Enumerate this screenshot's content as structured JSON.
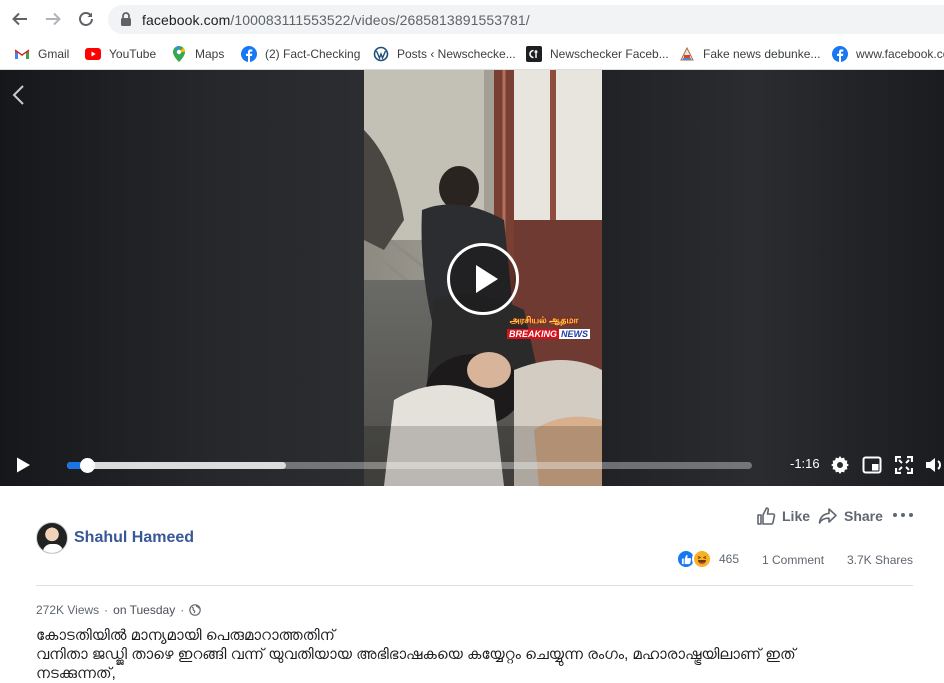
{
  "browser": {
    "url_host": "facebook.com",
    "url_path": "/100083111553522/videos/2685813891553781/",
    "bookmarks": [
      {
        "label": "Gmail",
        "icon": "gmail-icon"
      },
      {
        "label": "YouTube",
        "icon": "youtube-icon"
      },
      {
        "label": "Maps",
        "icon": "maps-icon"
      },
      {
        "label": "(2) Fact-Checking",
        "icon": "facebook-icon"
      },
      {
        "label": "Posts ‹ Newschecke...",
        "icon": "wordpress-icon"
      },
      {
        "label": "Newschecker Faceb...",
        "icon": "crowdtangle-icon"
      },
      {
        "label": "Fake news debunke...",
        "icon": "debunk-icon"
      },
      {
        "label": "www.facebook.co",
        "icon": "facebook-icon"
      }
    ]
  },
  "video": {
    "overlay_tamil": "அரசியல் ஆதமா",
    "overlay_breaking": "BREAKING",
    "overlay_news": "NEWS",
    "time_remaining": "-1:16",
    "progress_fraction": 0.03,
    "buffered_fraction": 0.32
  },
  "post": {
    "author": "Shahul Hameed",
    "like_label": "Like",
    "share_label": "Share",
    "reaction_count": "465",
    "comments": "1 Comment",
    "shares": "3.7K Shares",
    "views": "272K Views",
    "date": "on Tuesday",
    "description_line1": "കോടതിയിൽ മാന്യമായി പെരുമാറാത്തതിന്",
    "description_line2": "വനിതാ ജഡ്ജി താഴെ ഇറങ്ങി വന്ന് യുവതിയായ അഭിഭാഷകയെ കയ്യേറ്റം ചെയ്യുന്ന രംഗം, മഹാരാഷ്ട്രയിലാണ് ഇത്",
    "description_line3": "നടക്കുന്നത്,"
  },
  "colors": {
    "facebook_blue": "#1877f2",
    "author_blue": "#385898",
    "progress_blue": "#1b74e4"
  }
}
